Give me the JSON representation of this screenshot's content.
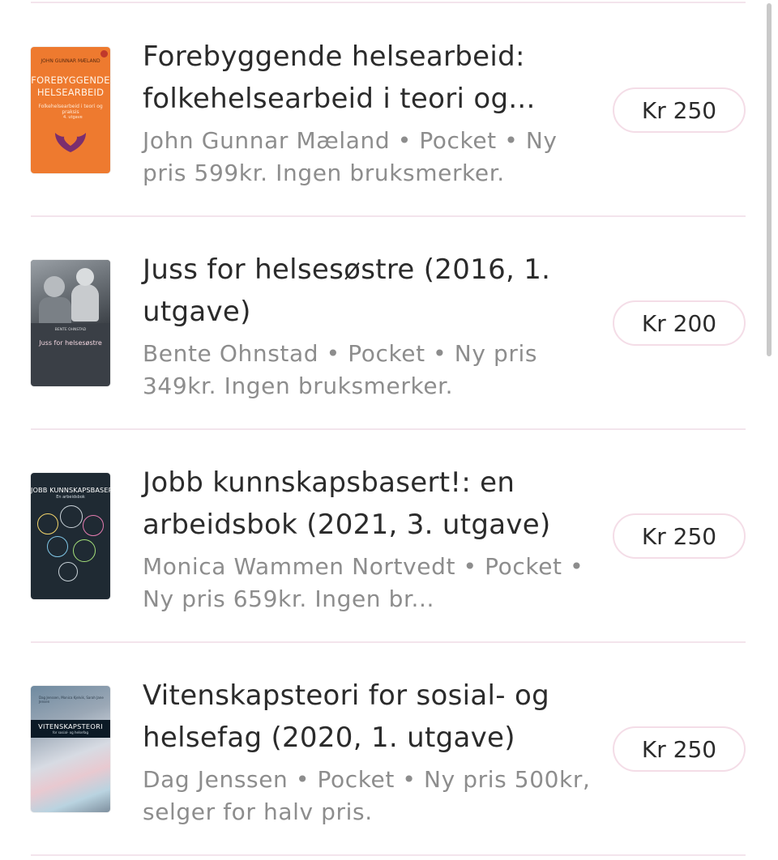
{
  "listings": [
    {
      "title": "Forebyggende helsearbeid: folkehelsearbeid i teori og...",
      "meta": "John Gunnar Mæland • Pocket • Ny pris 599kr. Ingen bruksmerker.",
      "price": "Kr 250",
      "cover": {
        "author": "JOHN GUNNAR MÆLAND",
        "title": "FOREBYGGENDE HELSEARBEID",
        "subtitle": "Folkehelsearbeid i teori og praksis",
        "edition": "4. utgave",
        "color": "#ee7a2f"
      }
    },
    {
      "title": "Juss for helsesøstre (2016, 1. utgave)",
      "meta": "Bente Ohnstad • Pocket • Ny pris 349kr. Ingen bruksmerker.",
      "price": "Kr 200",
      "cover": {
        "author": "BENTE OHNSTAD",
        "title": "Juss for helsesøstre",
        "color": "#3a3f46"
      }
    },
    {
      "title": "Jobb kunnskapsbasert!: en arbeidsbok (2021, 3. utgave)",
      "meta": "Monica Wammen Nortvedt • Pocket • Ny pris 659kr. Ingen br...",
      "price": "Kr 250",
      "cover": {
        "title": "JOBB KUNNSKAPSBASERT!",
        "subtitle": "En arbeidsbok",
        "color": "#1f2a33"
      }
    },
    {
      "title": "Vitenskapsteori for sosial- og helsefag (2020, 1. utgave)",
      "meta": "Dag Jenssen • Pocket • Ny pris 500kr, selger for halv pris.",
      "price": "Kr 250",
      "cover": {
        "authors": "Dag Jenssen, Monica Kjelvik, Sarah Jane Jensen",
        "title": "VITENSKAPSTEORI",
        "subtitle": "for sosial- og helsefag",
        "color": "#0c1a26"
      }
    }
  ],
  "colors": {
    "divider": "#f3e4ec",
    "button_border": "#f4dde7",
    "title_text": "#2b2b2b",
    "meta_text": "#8d8d8d"
  }
}
